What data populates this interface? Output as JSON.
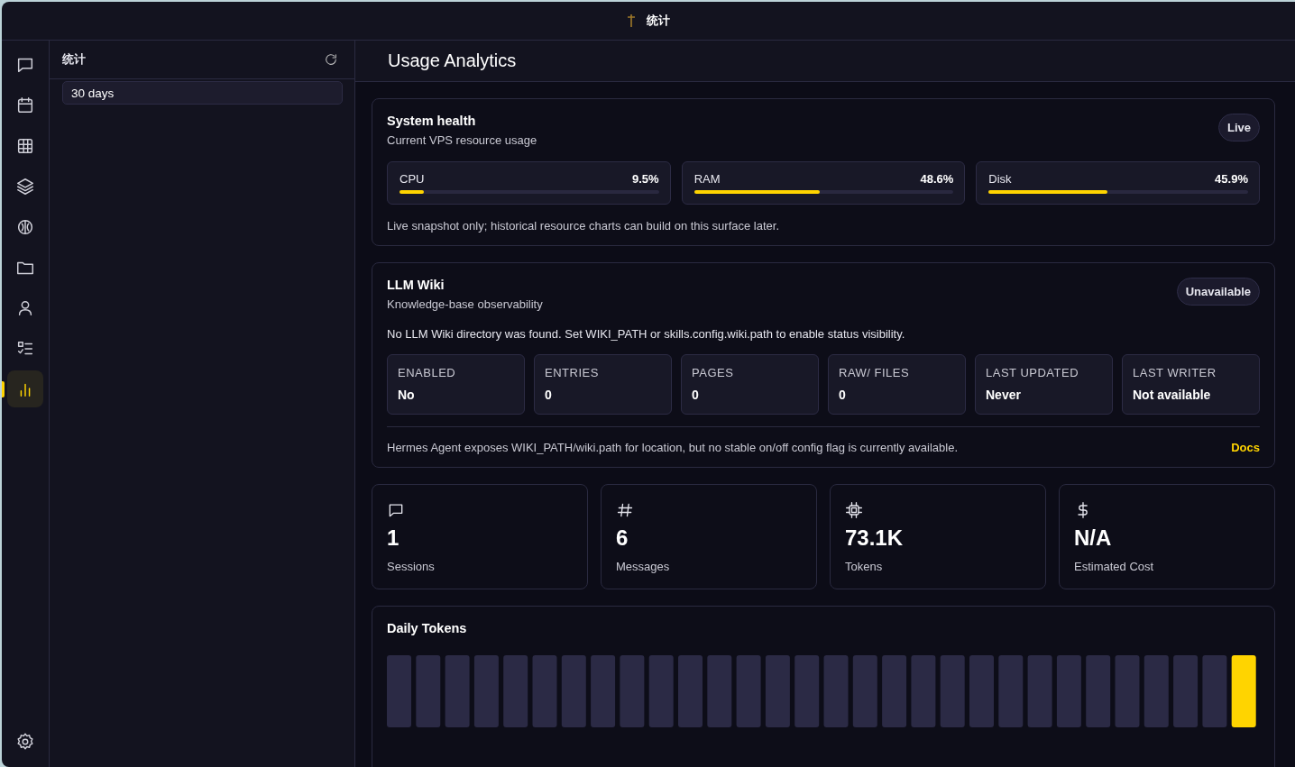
{
  "window": {
    "title": "统计"
  },
  "nav_items": [
    {
      "selected": false
    },
    {
      "selected": false
    },
    {
      "selected": false
    },
    {
      "selected": false
    },
    {
      "selected": false
    },
    {
      "selected": false
    },
    {
      "selected": false
    },
    {
      "selected": false
    },
    {
      "selected": true
    },
    {
      "selected": false
    }
  ],
  "sidebar": {
    "title": "统计",
    "range": "30 days"
  },
  "main": {
    "title": "Usage Analytics"
  },
  "system_health": {
    "title": "System health",
    "badge": "Live",
    "subtitle": "Current VPS resource usage",
    "meters": [
      {
        "name": "CPU",
        "reading": "9.5%",
        "level": 0.095
      },
      {
        "name": "RAM",
        "reading": "48.6%",
        "level": 0.486
      },
      {
        "name": "Disk",
        "reading": "45.9%",
        "level": 0.459
      }
    ],
    "note": "Live snapshot only; historical resource charts can build on this surface later."
  },
  "llm_wiki": {
    "title": "LLM Wiki",
    "badge": "Unavailable",
    "subtitle": "Knowledge-base observability",
    "message": "No LLM Wiki directory was found. Set WIKI_PATH or skills.config.wiki.path to enable status visibility.",
    "stats": [
      {
        "label": "ENABLED",
        "value": "No"
      },
      {
        "label": "ENTRIES",
        "value": "0"
      },
      {
        "label": "PAGES",
        "value": "0"
      },
      {
        "label": "RAW/ FILES",
        "value": "0"
      },
      {
        "label": "LAST UPDATED",
        "value": "Never"
      },
      {
        "label": "LAST WRITER",
        "value": "Not available"
      }
    ],
    "footer": "Hermes Agent exposes WIKI_PATH/wiki.path for location, but no stable on/off config flag is currently available.",
    "link": "Docs"
  },
  "summary": [
    {
      "value": "1",
      "label": "Sessions"
    },
    {
      "value": "6",
      "label": "Messages"
    },
    {
      "value": "73.1K",
      "label": "Tokens"
    },
    {
      "value": "N/A",
      "label": "Estimated Cost"
    }
  ],
  "daily_tokens": {
    "title": "Daily Tokens"
  }
}
